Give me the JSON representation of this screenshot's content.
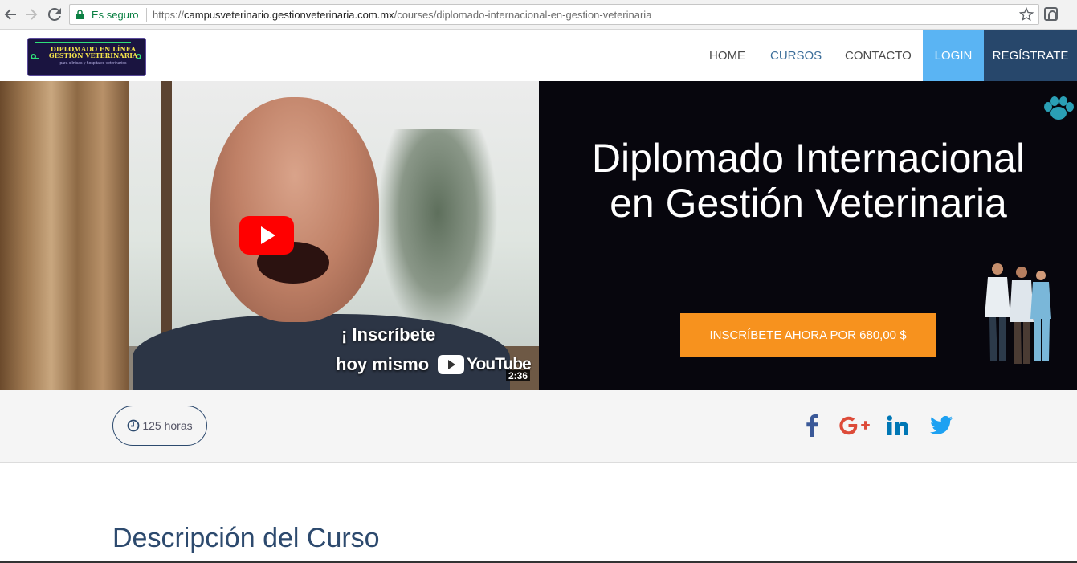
{
  "browser": {
    "secure_label": "Es seguro",
    "url_scheme": "https://",
    "url_host": "campusveterinario.gestionveterinaria.com.mx",
    "url_path": "/courses/diplomado-internacional-en-gestion-veterinaria"
  },
  "logo": {
    "line1": "DIPLOMADO EN LÍNEA",
    "line2": "GESTIÓN VETERINARIA",
    "line3": "para clínicas y hospitales veterinarios"
  },
  "nav": {
    "home": "HOME",
    "cursos": "CURSOS",
    "contacto": "CONTACTO",
    "login": "LOGIN",
    "register": "REGÍSTRATE"
  },
  "video": {
    "caption_line1": "¡ Inscríbete",
    "caption_line2": "hoy mismo",
    "brand": "YouTube",
    "duration": "2:36"
  },
  "hero": {
    "title_line1": "Diplomado Internacional",
    "title_line2": "en Gestión Veterinaria",
    "cta": "INSCRÍBETE AHORA POR 680,00 $"
  },
  "info": {
    "hours": "125 horas",
    "social": [
      "facebook",
      "google-plus",
      "linkedin",
      "twitter"
    ]
  },
  "description": {
    "title": "Descripción del Curso"
  },
  "colors": {
    "login_bg": "#5ab4f3",
    "register_bg": "#27476b",
    "cta_bg": "#f7921e",
    "hero_bg": "#07060d",
    "facebook": "#3b5998",
    "google_plus": "#dd4b39",
    "linkedin": "#0077b5",
    "twitter": "#1da1f2"
  }
}
